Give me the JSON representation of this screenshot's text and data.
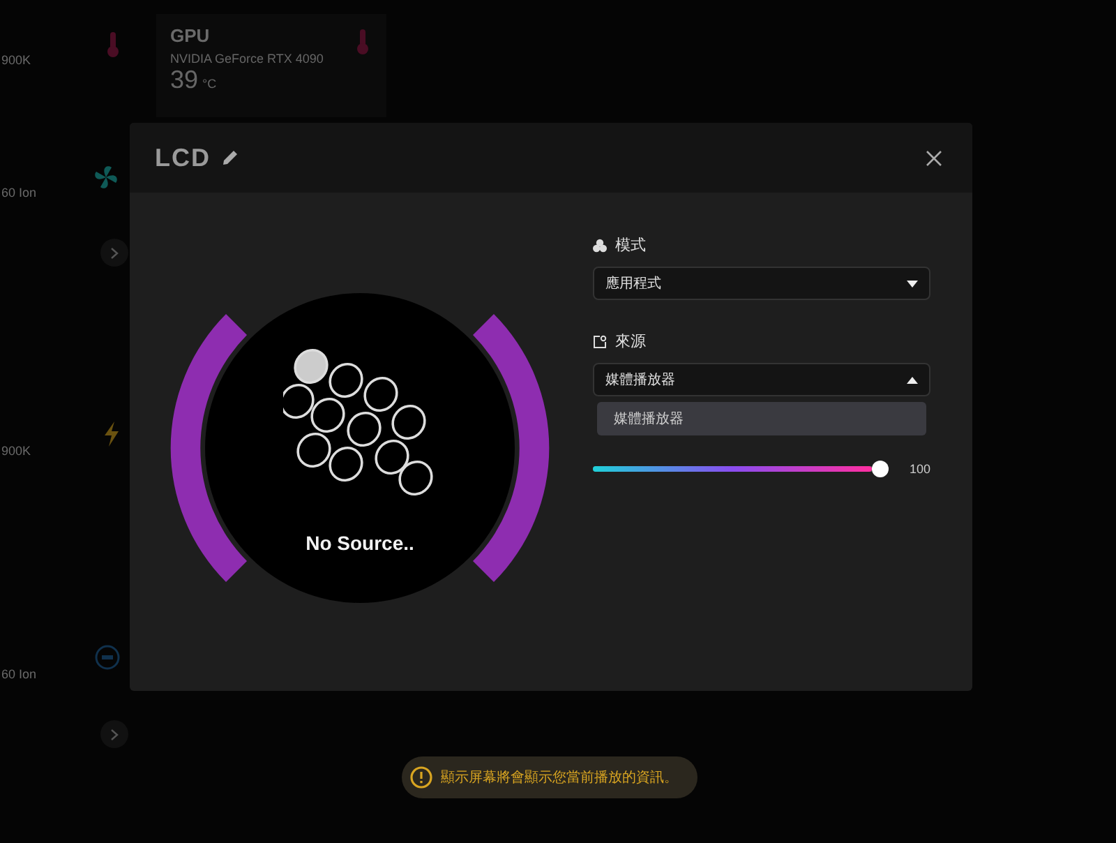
{
  "background": {
    "side_cards": [
      {
        "kind": "temperature",
        "subtitle": "900K",
        "has_more": false
      },
      {
        "kind": "fan",
        "subtitle": "60 Ion",
        "has_more": true
      },
      {
        "kind": "power",
        "subtitle": "900K",
        "has_more": false
      },
      {
        "kind": "lcd",
        "subtitle": "60 Ion",
        "has_more": true
      }
    ],
    "gpu_card": {
      "title": "GPU",
      "subtitle": "NVIDIA GeForce RTX 4090",
      "value": "39",
      "unit": "°C"
    }
  },
  "dialog": {
    "title": "LCD",
    "preview": {
      "message": "No Source.."
    },
    "mode": {
      "label": "模式",
      "value": "應用程式",
      "expanded": false
    },
    "source": {
      "label": "來源",
      "value": "媒體播放器",
      "expanded": true,
      "options": [
        {
          "label": "媒體播放器",
          "selected": true
        }
      ]
    },
    "slider": {
      "level": 1,
      "reading": "100"
    }
  },
  "toast": {
    "message": "顯示屏幕將會顯示您當前播放的資訊。"
  }
}
